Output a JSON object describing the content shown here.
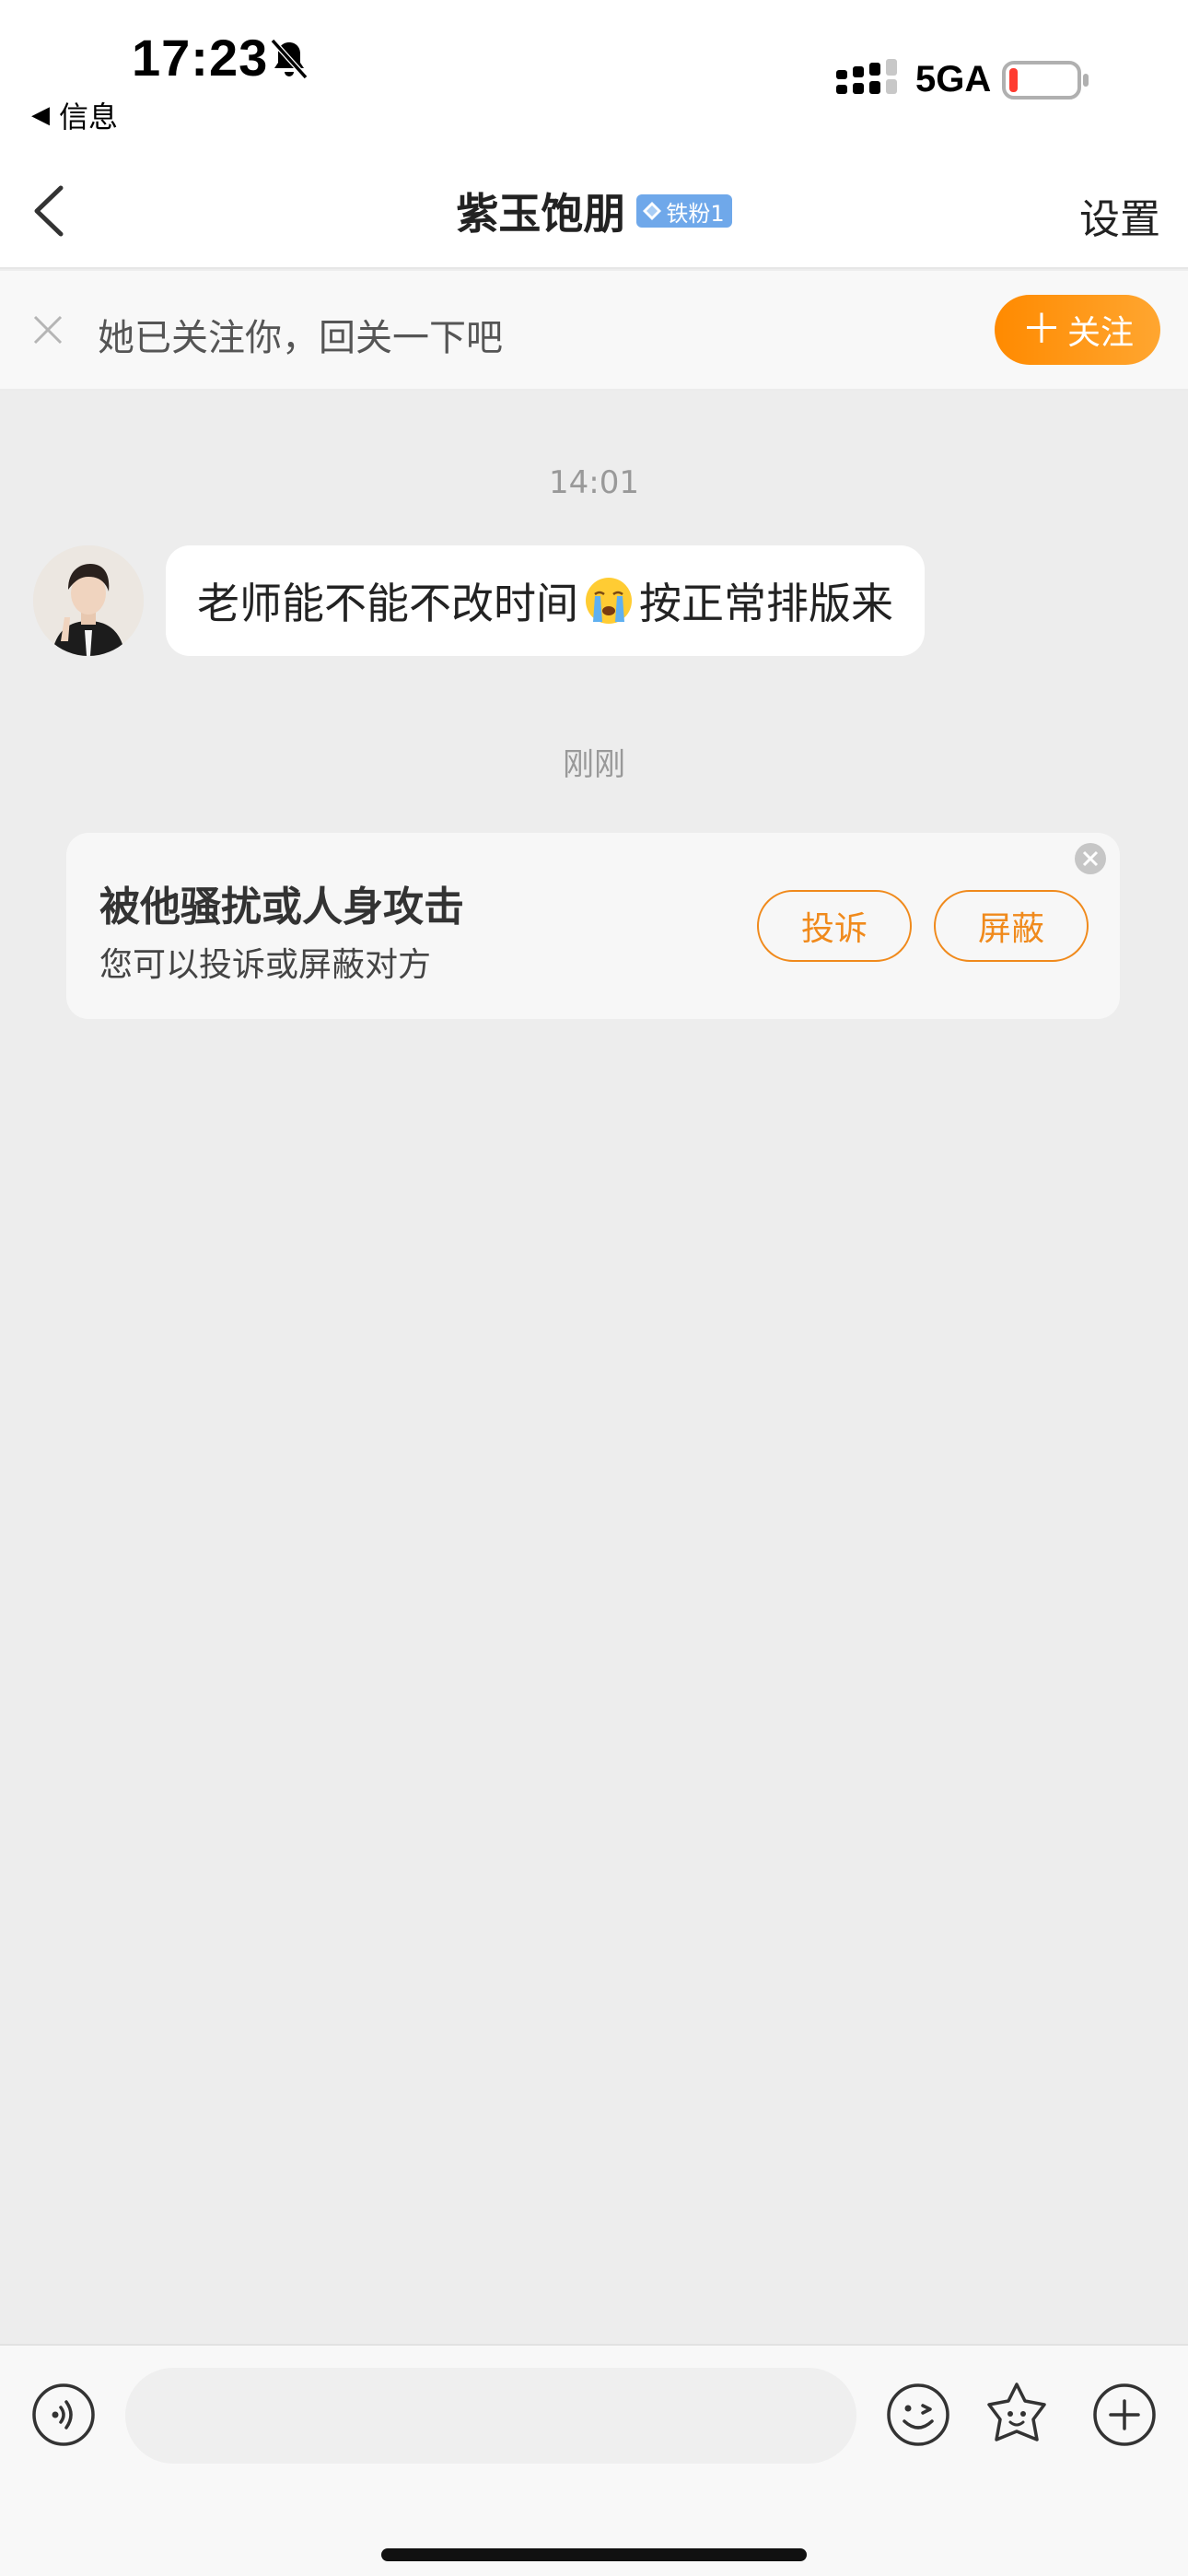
{
  "status_bar": {
    "time": "17:23",
    "back_app_label": "信息",
    "network": "5GA",
    "battery_color": "#ff3b30"
  },
  "nav": {
    "title": "紫玉饱朋",
    "fan_badge": "铁粉1",
    "settings_label": "设置"
  },
  "follow_prompt": {
    "text": "她已关注你，回关一下吧",
    "button_label": "关注",
    "button_plus": "＋"
  },
  "chat": {
    "messages": [
      {
        "timestamp": "14:01",
        "text_before_emoji": "老师能不能不改时间",
        "emoji": "crying-face-icon",
        "text_after_emoji": "按正常排版来"
      }
    ],
    "second_timestamp": "刚刚",
    "harassment_card": {
      "title": "被他骚扰或人身攻击",
      "subtitle": "您可以投诉或屏蔽对方",
      "report_label": "投诉",
      "block_label": "屏蔽"
    }
  },
  "input_bar": {
    "placeholder": "",
    "icons": [
      "voice-icon",
      "wink-emoji-icon",
      "sticker-icon",
      "plus-icon"
    ]
  },
  "colors": {
    "accent_orange": "#ff8a00",
    "badge_blue": "#6fa8ea",
    "chat_background": "#ededed"
  }
}
